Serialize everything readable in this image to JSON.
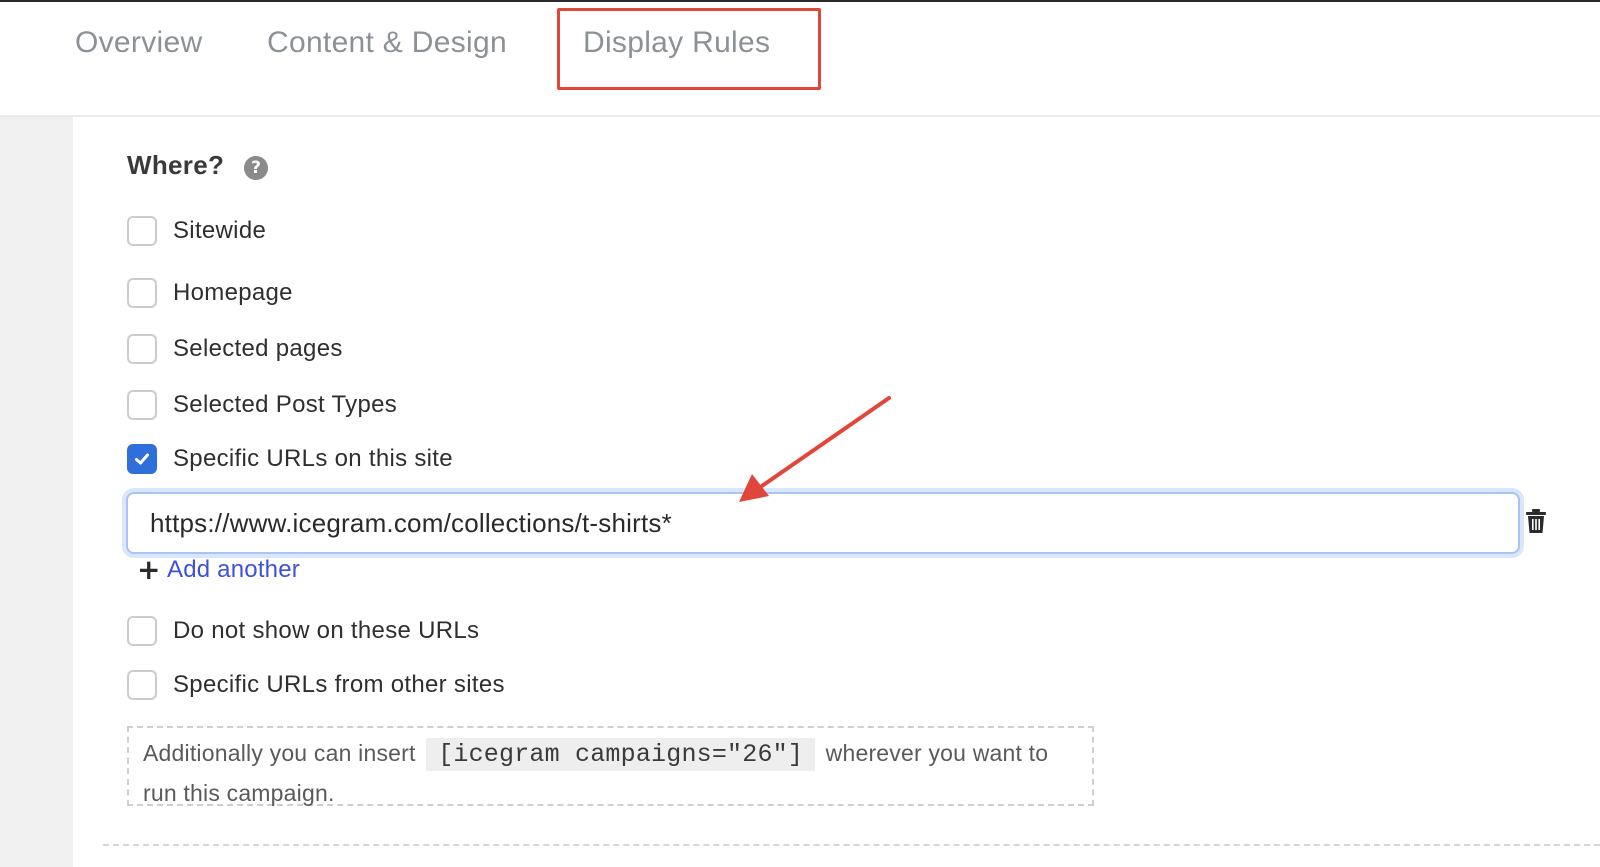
{
  "tabs": [
    {
      "label": "Overview"
    },
    {
      "label": "Content & Design"
    },
    {
      "label": "Display Rules"
    }
  ],
  "where": {
    "title": "Where?",
    "help_icon": "question-circle-icon",
    "options": [
      {
        "label": "Sitewide",
        "checked": false
      },
      {
        "label": "Homepage",
        "checked": false
      },
      {
        "label": "Selected pages",
        "checked": false
      },
      {
        "label": "Selected Post Types",
        "checked": false
      },
      {
        "label": "Specific URLs on this site",
        "checked": true
      },
      {
        "label": "Do not show on these URLs",
        "checked": false
      },
      {
        "label": "Specific URLs from other sites",
        "checked": false
      }
    ],
    "url_value": "https://www.icegram.com/collections/t-shirts*",
    "add_another_label": "Add another",
    "add_icon": "plus-icon",
    "delete_icon": "trash-icon"
  },
  "shortcode_note": {
    "prefix": "Additionally you can insert",
    "code": "[icegram campaigns=\"26\"]",
    "suffix": "wherever you want to run this campaign."
  },
  "colors": {
    "accent": "#2f6fdc",
    "link": "#3f51d8",
    "annotation": "#e0463a"
  }
}
